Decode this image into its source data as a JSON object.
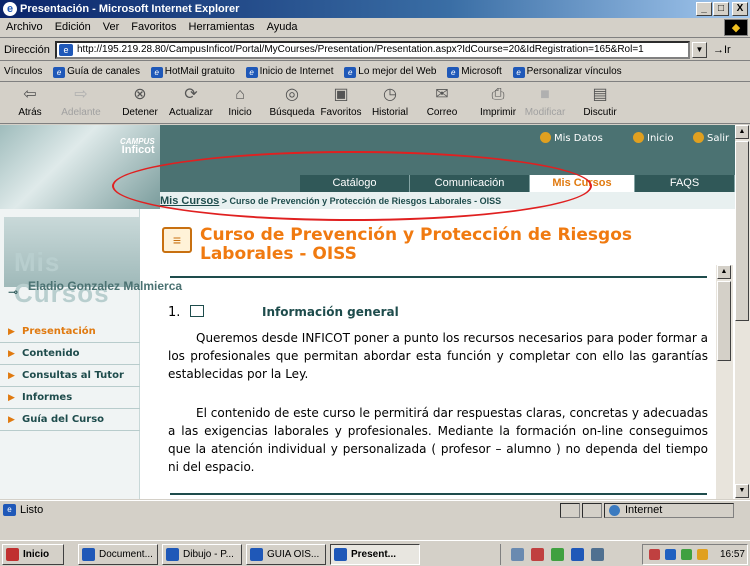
{
  "window": {
    "title": "Presentación - Microsoft Internet Explorer",
    "minimize": "_",
    "maximize": "□",
    "close": "X"
  },
  "menu": [
    "Archivo",
    "Edición",
    "Ver",
    "Favoritos",
    "Herramientas",
    "Ayuda"
  ],
  "address": {
    "label": "Dirección",
    "url": "http://195.219.28.80/CampusInficot/Portal/MyCourses/Presentation/Presentation.aspx?IdCourse=20&IdRegistration=165&Rol=1",
    "go": "Ir"
  },
  "links": {
    "label": "Vínculos",
    "items": [
      "Guía de canales",
      "HotMail gratuito",
      "Inicio de Internet",
      "Lo mejor del Web",
      "Microsoft",
      "Personalizar vínculos"
    ]
  },
  "toolbar": {
    "back": "Atrás",
    "forward": "Adelante",
    "stop": "Detener",
    "refresh": "Actualizar",
    "home": "Inicio",
    "search": "Búsqueda",
    "favorites": "Favoritos",
    "history": "Historial",
    "mail": "Correo",
    "print": "Imprimir",
    "edit": "Modificar",
    "discuss": "Discutir"
  },
  "site": {
    "brand_top": "CAMPUS",
    "brand_name": "Inficot",
    "top_links": [
      "Mis Datos",
      "Inicio",
      "Salir"
    ],
    "tabs": [
      "Catálogo",
      "Comunicación",
      "Mis Cursos",
      "FAQS"
    ],
    "active_tab": "Mis Cursos",
    "breadcrumb_link": "Mis Cursos",
    "breadcrumb_rest": " > Curso de Prevención y Protección de Riesgos Laborales - OISS"
  },
  "sidebar": {
    "heading": "Mis Cursos",
    "user": "Eladio Gonzalez Malmierca",
    "items": [
      "Presentación",
      "Contenido",
      "Consultas al Tutor",
      "Informes",
      "Guía del Curso"
    ],
    "active": "Presentación"
  },
  "main": {
    "title": "Curso de Prevención y Protección de Riesgos Laborales - OISS",
    "section_number": "1.",
    "section_title": "Información general",
    "paragraph1": "Queremos desde INFICOT poner a punto los recursos necesarios para poder formar a los profesionales que permitan abordar esta función y completar con ello las garantías establecidas por la Ley.",
    "paragraph2": "El contenido de este curso le permitirá dar respuestas claras, concretas y adecuadas a las exigencias laborales y profesionales. Mediante la formación on-line conseguimos que la atención individual y personalizada ( profesor – alumno ) no dependa del tiempo ni del espacio."
  },
  "status": {
    "text": "Listo",
    "zone": "Internet"
  },
  "taskbar": {
    "start": "Inicio",
    "buttons": [
      "Document...",
      "Dibujo - P...",
      "GUIA OIS...",
      "Present..."
    ],
    "clock": "16:57"
  },
  "colors": {
    "header": "#4b7272",
    "accent": "#f07a10",
    "annotation": "#e02020"
  }
}
